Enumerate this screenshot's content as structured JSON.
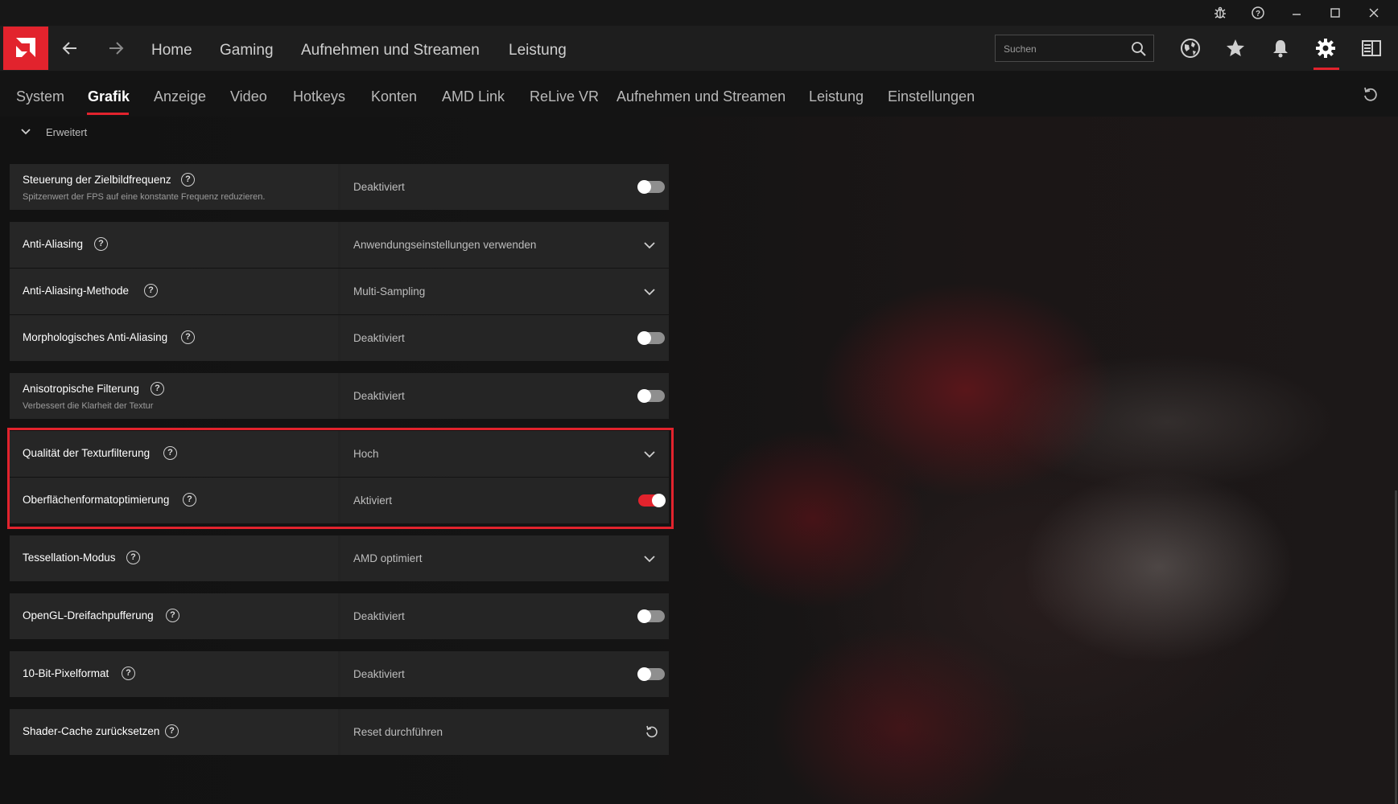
{
  "window": {
    "controls": [
      "bug-report",
      "help",
      "minimize",
      "maximize",
      "close"
    ]
  },
  "nav": {
    "items": [
      "Home",
      "Gaming",
      "Aufnehmen und Streamen",
      "Leistung"
    ]
  },
  "search": {
    "placeholder": "Suchen"
  },
  "tabs": {
    "items": [
      "System",
      "Grafik",
      "Anzeige",
      "Video",
      "Hotkeys",
      "Konten",
      "AMD Link",
      "ReLive VR",
      "Aufnehmen und Streamen",
      "Leistung",
      "Einstellungen"
    ],
    "active": "Grafik"
  },
  "section": {
    "title": "Erweitert"
  },
  "settings": [
    {
      "title": "Steuerung der Zielbildfrequenz",
      "subtitle": "Spitzenwert der FPS auf eine konstante Frequenz reduzieren.",
      "value": "Deaktiviert",
      "control": "toggle",
      "state": "off"
    },
    {
      "title": "Anti-Aliasing",
      "value": "Anwendungseinstellungen verwenden",
      "control": "dropdown"
    },
    {
      "title": "Anti-Aliasing-Methode",
      "value": "Multi-Sampling",
      "control": "dropdown"
    },
    {
      "title": "Morphologisches Anti-Aliasing",
      "value": "Deaktiviert",
      "control": "toggle",
      "state": "off"
    },
    {
      "title": "Anisotropische Filterung",
      "subtitle": "Verbessert die Klarheit der Textur",
      "value": "Deaktiviert",
      "control": "toggle",
      "state": "off"
    },
    {
      "title": "Qualität der Texturfilterung",
      "value": "Hoch",
      "control": "dropdown"
    },
    {
      "title": "Oberflächenformatoptimierung",
      "value": "Aktiviert",
      "control": "toggle",
      "state": "on"
    },
    {
      "title": "Tessellation-Modus",
      "value": "AMD optimiert",
      "control": "dropdown"
    },
    {
      "title": "OpenGL-Dreifachpufferung",
      "value": "Deaktiviert",
      "control": "toggle",
      "state": "off"
    },
    {
      "title": "10-Bit-Pixelformat",
      "value": "Deaktiviert",
      "control": "toggle",
      "state": "off"
    },
    {
      "title": "Shader-Cache zurücksetzen",
      "value": "Reset durchführen",
      "control": "reset"
    }
  ],
  "colors": {
    "accent": "#e2232d",
    "background": "#0f0f0f",
    "panel": "#262626"
  }
}
